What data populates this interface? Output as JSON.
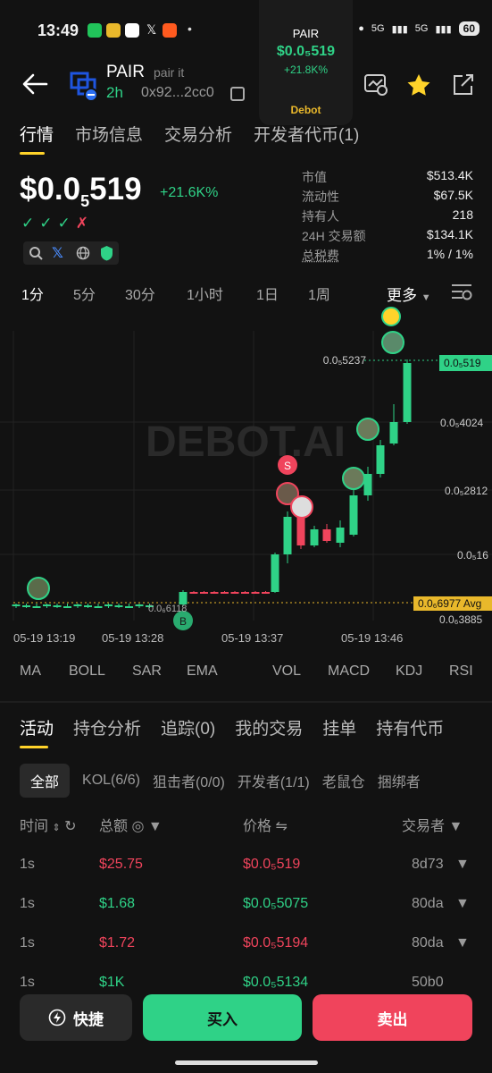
{
  "status_bar": {
    "time": "13:49",
    "battery": "60",
    "signal_labels": [
      "5G",
      "5G"
    ]
  },
  "widget": {
    "pair": "PAIR",
    "price": "$0.0₅519",
    "change": "+21.8K%",
    "brand": "Debot"
  },
  "header": {
    "pair_name": "PAIR",
    "pair_sub": "pair it",
    "age": "2h",
    "address": "0x92...2cc0"
  },
  "main_tabs": [
    "行情",
    "市场信息",
    "交易分析",
    "开发者代币(1)"
  ],
  "price": {
    "main": "$0.0",
    "sub": "5",
    "tail": "519",
    "change": "+21.6K%"
  },
  "checks": [
    "✓",
    "✓",
    "✓",
    "✗"
  ],
  "stats": [
    {
      "k": "市值",
      "v": "$513.4K"
    },
    {
      "k": "流动性",
      "v": "$67.5K"
    },
    {
      "k": "持有人",
      "v": "218"
    },
    {
      "k": "24H 交易额",
      "v": "$134.1K"
    },
    {
      "k": "总税费",
      "v": "1% / 1%"
    }
  ],
  "intervals": [
    "1分",
    "5分",
    "30分",
    "1小时",
    "1日",
    "1周"
  ],
  "more_label": "更多",
  "chart_data": {
    "type": "candlestick",
    "watermark": "DEBOT.AI",
    "y_labels": [
      "0.0₅5237",
      "0.0₅4024",
      "0.0₅2812",
      "0.0₅16",
      "0.0₆6977 Avg",
      "0.0₆3885"
    ],
    "current_label": "0.0₅519",
    "low_label": "0.0₆6118",
    "x_labels": [
      "05-19 13:19",
      "05-19 13:28",
      "05-19 13:37",
      "05-19 13:46"
    ],
    "markers": [
      "S",
      "B"
    ]
  },
  "indicators": [
    "MA",
    "BOLL",
    "SAR",
    "EMA",
    "VOL",
    "MACD",
    "KDJ",
    "RSI"
  ],
  "activity_tabs": [
    "活动",
    "持仓分析",
    "追踪(0)",
    "我的交易",
    "挂单",
    "持有代币"
  ],
  "filters": [
    "全部",
    "KOL(6/6)",
    "狙击者(0/0)",
    "开发者(1/1)",
    "老鼠仓",
    "捆绑者"
  ],
  "table_headers": {
    "time": "时间",
    "amount": "总额",
    "price": "价格",
    "trader": "交易者"
  },
  "trades": [
    {
      "time": "1s",
      "amount": "$25.75",
      "price": "$0.0₅519",
      "trader": "8d73",
      "side": "sell"
    },
    {
      "time": "1s",
      "amount": "$1.68",
      "price": "$0.0₅5075",
      "trader": "80da",
      "side": "buy"
    },
    {
      "time": "1s",
      "amount": "$1.72",
      "price": "$0.0₅5194",
      "trader": "80da",
      "side": "sell"
    },
    {
      "time": "1s",
      "amount": "$1K",
      "price": "$0.0₅5134",
      "trader": "50b0",
      "side": "buy"
    }
  ],
  "buttons": {
    "quick": "快捷",
    "buy": "买入",
    "sell": "卖出"
  },
  "colors": {
    "up": "#2fd287",
    "down": "#f0445c",
    "accent": "#ffd32a",
    "bg": "#121212"
  }
}
